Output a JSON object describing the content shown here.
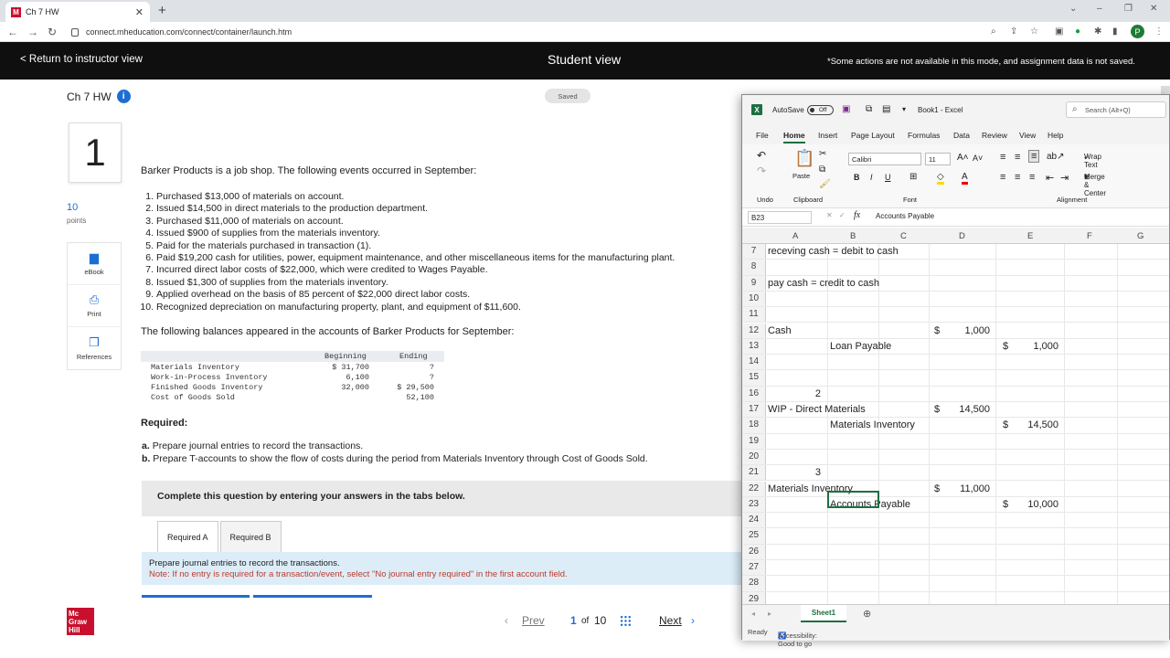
{
  "browser": {
    "tab_title": "Ch 7 HW",
    "favicon_letter": "M",
    "url": "connect.mheducation.com/connect/container/launch.htm",
    "profile_initial": "P"
  },
  "student_bar": {
    "return_link": "< Return to instructor view",
    "title": "Student view",
    "note": "*Some actions are not available in this mode, and assignment data is not saved."
  },
  "assignment": {
    "title": "Ch 7 HW",
    "saved_label": "Saved",
    "question_number": "1",
    "points_value": "10",
    "points_label": "points",
    "tools": [
      "eBook",
      "Print",
      "References"
    ],
    "intro": "Barker Products is a job shop. The following events occurred in September:",
    "events": [
      {
        "n": "1.",
        "t": "Purchased $13,000 of materials on account."
      },
      {
        "n": "2.",
        "t": "Issued $14,500 in direct materials to the production department."
      },
      {
        "n": "3.",
        "t": "Purchased $11,000 of materials on account."
      },
      {
        "n": "4.",
        "t": "Issued $900 of supplies from the materials inventory."
      },
      {
        "n": "5.",
        "t": "Paid for the materials purchased in transaction (1)."
      },
      {
        "n": "6.",
        "t": "Paid $19,200 cash for utilities, power, equipment maintenance, and other miscellaneous items for the manufacturing plant."
      },
      {
        "n": "7.",
        "t": "Incurred direct labor costs of $22,000, which were credited to Wages Payable."
      },
      {
        "n": "8.",
        "t": "Issued $1,300 of supplies from the materials inventory."
      },
      {
        "n": "9.",
        "t": "Applied overhead on the basis of 85 percent of $22,000 direct labor costs."
      },
      {
        "n": "10.",
        "t": "Recognized depreciation on manufacturing property, plant, and equipment of $11,600."
      }
    ],
    "balances_intro": "The following balances appeared in the accounts of Barker Products for September:",
    "balances_headers": [
      "Beginning",
      "Ending"
    ],
    "balances_rows": [
      {
        "account": "Materials Inventory",
        "beginning": "$ 31,700",
        "ending": "?"
      },
      {
        "account": "Work-in-Process Inventory",
        "beginning": "6,100",
        "ending": "?"
      },
      {
        "account": "Finished Goods Inventory",
        "beginning": "32,000",
        "ending": "$ 29,500"
      },
      {
        "account": "Cost of Goods Sold",
        "beginning": "",
        "ending": "52,100"
      }
    ],
    "required_label": "Required:",
    "required_items": [
      {
        "k": "a.",
        "t": "Prepare journal entries to record the transactions."
      },
      {
        "k": "b.",
        "t": "Prepare T-accounts to show the flow of costs during the period from Materials Inventory through Cost of Goods Sold."
      }
    ],
    "complete_banner": "Complete this question by entering your answers in the tabs below.",
    "tabs": [
      "Required A",
      "Required B"
    ],
    "instruction": "Prepare journal entries to record the transactions.",
    "note": "Note: If no entry is required for a transaction/event, select \"No journal entry required\" in the first account field."
  },
  "pager": {
    "prev": "Prev",
    "current": "1",
    "of": "of",
    "total": "10",
    "next": "Next"
  },
  "publisher_logo": "Mc Graw Hill",
  "excel": {
    "autosave_label": "AutoSave",
    "autosave_state": "Off",
    "file_title": "Book1 - Excel",
    "search_placeholder": "Search (Alt+Q)",
    "menus": [
      "File",
      "Home",
      "Insert",
      "Page Layout",
      "Formulas",
      "Data",
      "Review",
      "View",
      "Help"
    ],
    "ribbon": {
      "undo": "Undo",
      "paste": "Paste",
      "clipboard": "Clipboard",
      "font_name": "Calibri",
      "font_size": "11",
      "font_group": "Font",
      "wrap_text": "Wrap Text",
      "merge_center": "Merge & Center",
      "alignment_group": "Alignment"
    },
    "name_box": "B23",
    "formula": "Accounts Payable",
    "columns": [
      "A",
      "B",
      "C",
      "D",
      "E",
      "F",
      "G"
    ],
    "rows": [
      {
        "n": "7",
        "a": "receving cash = debit to cash"
      },
      {
        "n": "8"
      },
      {
        "n": "9",
        "a": "pay cash = credit to cash"
      },
      {
        "n": "10"
      },
      {
        "n": "11"
      },
      {
        "n": "12",
        "a": "Cash",
        "d_sym": "$",
        "d": "1,000"
      },
      {
        "n": "13",
        "b": "Loan Payable",
        "e_sym": "$",
        "e": "1,000"
      },
      {
        "n": "14"
      },
      {
        "n": "15"
      },
      {
        "n": "16",
        "b_num": "2"
      },
      {
        "n": "17",
        "a": "WIP - Direct Materials",
        "d_sym": "$",
        "d": "14,500"
      },
      {
        "n": "18",
        "b": "Materials Inventory",
        "e_sym": "$",
        "e": "14,500"
      },
      {
        "n": "19"
      },
      {
        "n": "20"
      },
      {
        "n": "21",
        "b_num": "3"
      },
      {
        "n": "22",
        "a": "Materials Inventory",
        "d_sym": "$",
        "d": "11,000"
      },
      {
        "n": "23",
        "b": "Accounts Payable",
        "e_sym": "$",
        "e": "10,000"
      },
      {
        "n": "24"
      },
      {
        "n": "25"
      },
      {
        "n": "26"
      },
      {
        "n": "27"
      },
      {
        "n": "28"
      },
      {
        "n": "29"
      }
    ],
    "sheet_tab": "Sheet1",
    "status_ready": "Ready",
    "status_accessibility": "Accessibility: Good to go"
  }
}
